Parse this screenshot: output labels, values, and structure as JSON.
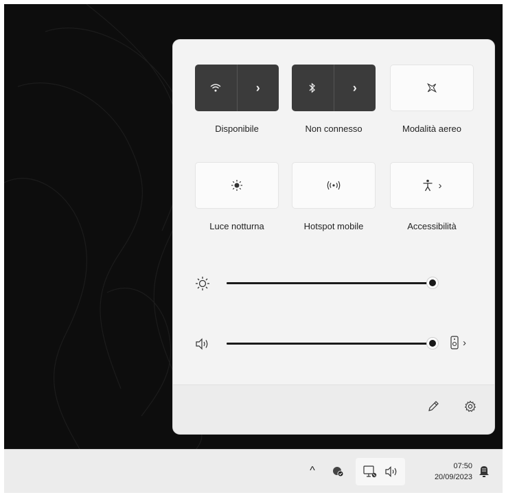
{
  "quick_settings": {
    "tiles": [
      {
        "label": "Disponibile",
        "state": "on",
        "icon": "wifi-icon",
        "has_chevron": true
      },
      {
        "label": "Non connesso",
        "state": "on",
        "icon": "bluetooth-icon",
        "has_chevron": true
      },
      {
        "label": "Modalità aereo",
        "state": "off",
        "icon": "airplane-icon",
        "has_chevron": false
      },
      {
        "label": "Luce notturna",
        "state": "off",
        "icon": "night-light-icon",
        "has_chevron": false
      },
      {
        "label": "Hotspot mobile",
        "state": "off",
        "icon": "hotspot-icon",
        "has_chevron": false
      },
      {
        "label": "Accessibilità",
        "state": "off",
        "icon": "accessibility-icon",
        "has_chevron": true
      }
    ],
    "chevron": "›",
    "brightness": {
      "icon": "brightness-icon",
      "level_percent": 100
    },
    "volume": {
      "icon": "speaker-icon",
      "level_percent": 100,
      "output_icon": "audio-output-icon"
    },
    "footer": {
      "edit_icon": "pencil-icon",
      "settings_icon": "gear-icon"
    }
  },
  "taskbar": {
    "overflow_chevron": "^",
    "clock_time": "07:50",
    "clock_date": "20/09/2023",
    "icons": [
      "chevron-up-icon",
      "security-icon",
      "network-icon",
      "volume-icon",
      "notification-icon"
    ]
  },
  "colors": {
    "tile_active": "#3b3b3b",
    "panel_bg": "#f3f3f3",
    "desktop_bg": "#0d0d0d"
  }
}
